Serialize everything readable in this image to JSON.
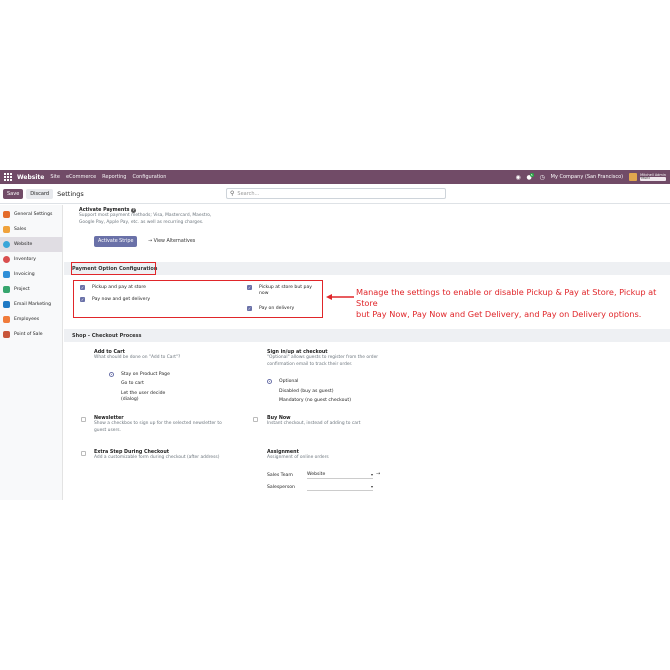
{
  "navbar": {
    "brand": "Website",
    "menu": [
      "Site",
      "eCommerce",
      "Reporting",
      "Configuration"
    ],
    "chat_badge": "5",
    "company": "My Company (San Francisco)",
    "user_name": "Mitchell Admin",
    "db_name": "Multi"
  },
  "control_panel": {
    "save_label": "Save",
    "discard_label": "Discard",
    "title": "Settings",
    "search_placeholder": "Search..."
  },
  "sidebar": {
    "items": [
      {
        "label": "General Settings",
        "color": "#e46c2a",
        "icon": "general-settings-icon"
      },
      {
        "label": "Sales",
        "color": "#f0a23b",
        "icon": "sales-icon"
      },
      {
        "label": "Website",
        "color": "#3aa6d9",
        "icon": "website-icon"
      },
      {
        "label": "Inventory",
        "color": "#d94e4e",
        "icon": "inventory-icon"
      },
      {
        "label": "Invoicing",
        "color": "#2f8fd8",
        "icon": "invoicing-icon"
      },
      {
        "label": "Project",
        "color": "#36a56d",
        "icon": "project-icon"
      },
      {
        "label": "Email Marketing",
        "color": "#1f7ac4",
        "icon": "email-marketing-icon"
      },
      {
        "label": "Employees",
        "color": "#f07b3a",
        "icon": "employees-icon"
      },
      {
        "label": "Point of Sale",
        "color": "#c8563a",
        "icon": "point-of-sale-icon"
      }
    ],
    "active_index": 2
  },
  "activate_payments": {
    "title": "Activate Payments",
    "desc1": "Support most payment methods; Visa, Mastercard, Maestro,",
    "desc2": "Google Pay, Apple Pay, etc. as well as recurring charges.",
    "button": "Activate Stripe",
    "alt_link": "View Alternatives"
  },
  "payment_option": {
    "header": "Payment Option Configuration",
    "pickup_pay_store": "Pickup and pay at store",
    "pay_now_delivery": "Pay now and get delivery",
    "pickup_store_pay_now_1": "Pickup at store but pay",
    "pickup_store_pay_now_2": "now",
    "pay_on_delivery": "Pay on delivery"
  },
  "annotation": {
    "line1": "Manage the settings to enable or disable Pickup & Pay at Store, Pickup at Store",
    "line2": "but Pay Now, Pay Now and Get Delivery, and Pay on Delivery options."
  },
  "checkout": {
    "header": "Shop - Checkout Process",
    "add_to_cart_title": "Add to Cart",
    "add_to_cart_desc": "What should be done on \"Add to Cart\"?",
    "opt_stay": "Stay on Product Page",
    "opt_goto": "Go to cart",
    "opt_let1": "Let the user decide",
    "opt_let2": "(dialog)",
    "signin_title": "Sign in/up at checkout",
    "signin_desc1": "\"Optional\" allows guests to register from the order",
    "signin_desc2": "confirmation email to track their order.",
    "opt_optional": "Optional",
    "opt_disabled": "Disabled (buy as guest)",
    "opt_mandatory": "Mandatory (no guest checkout)",
    "newsletter_title": "Newsletter",
    "newsletter_desc1": "Show a checkbox to sign up for the selected newsletter to",
    "newsletter_desc2": "guest users.",
    "buynow_title": "Buy Now",
    "buynow_desc": "Instant checkout, instead of adding to cart",
    "extra_title": "Extra Step During Checkout",
    "extra_desc": "Add a customizable form during checkout (after address)",
    "assign_title": "Assignment",
    "assign_desc": "Assignment of online orders",
    "sales_team_label": "Sales Team",
    "sales_team_value": "Website",
    "salesperson_label": "Salesperson"
  }
}
